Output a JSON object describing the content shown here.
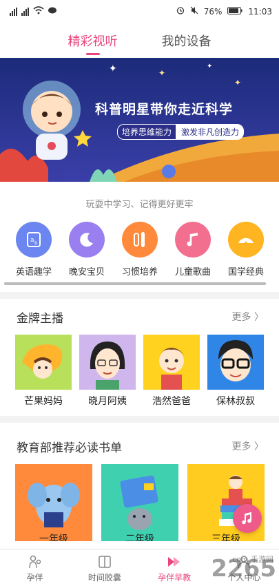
{
  "status": {
    "battery": "76%",
    "time": "11:03"
  },
  "tabs": [
    {
      "label": "精彩视听",
      "active": true
    },
    {
      "label": "我的设备",
      "active": false
    }
  ],
  "banner": {
    "title": "科普明星带你走近科学",
    "tag1": "培养思维能力",
    "tag2": "激发非凡创造力"
  },
  "tagline": "玩耍中学习、记得更好更牢",
  "categories": [
    {
      "label": "英语趣学",
      "color": "#6b86f0",
      "icon": "abc-card-icon"
    },
    {
      "label": "晚安宝贝",
      "color": "#9a7ff0",
      "icon": "moon-icon"
    },
    {
      "label": "习惯培养",
      "color": "#ff8a3c",
      "icon": "toothbrush-icon"
    },
    {
      "label": "儿童歌曲",
      "color": "#f26f8f",
      "icon": "music-note-icon"
    },
    {
      "label": "国学经典",
      "color": "#ffb521",
      "icon": "fan-icon"
    }
  ],
  "hosts_section": {
    "title": "金牌主播",
    "more": "更多"
  },
  "hosts": [
    {
      "name": "芒果妈妈",
      "bg": "#b9e05a"
    },
    {
      "name": "晓月阿姨",
      "bg": "#cfb7ee"
    },
    {
      "name": "浩然爸爸",
      "bg": "#ffd21f"
    },
    {
      "name": "保林叔叔",
      "bg": "#2f86e6"
    }
  ],
  "books_section": {
    "title": "教育部推荐必读书单",
    "more": "更多"
  },
  "books": [
    {
      "grade": "一年级",
      "bg": "#ff8a3c"
    },
    {
      "grade": "二年级",
      "bg": "#3fd0b0"
    },
    {
      "grade": "三年级",
      "bg": "#ffcc1f"
    }
  ],
  "nav": [
    {
      "label": "孕伴",
      "active": false
    },
    {
      "label": "时间胶囊",
      "active": false
    },
    {
      "label": "孕伴早教",
      "active": true
    },
    {
      "label": "个人中心",
      "active": false
    }
  ],
  "watermark": {
    "main": "2265",
    "sub": ".com 手游网"
  },
  "colors": {
    "accent": "#e8467c",
    "fab": "#ee5a8a"
  }
}
